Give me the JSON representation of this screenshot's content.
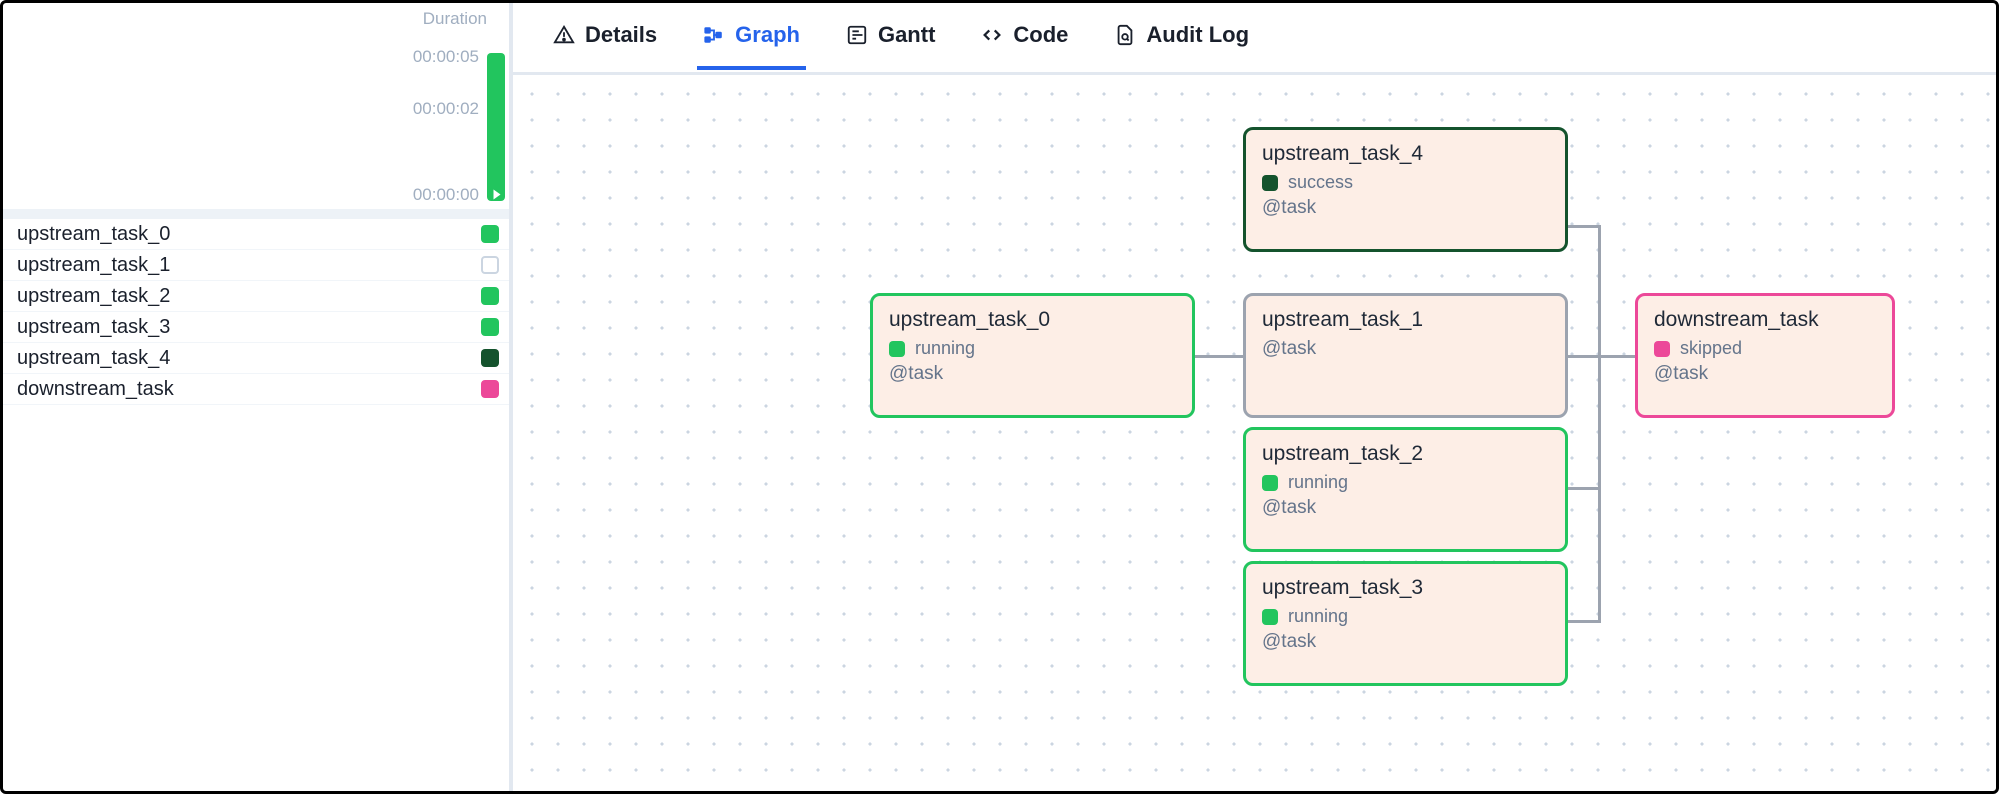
{
  "sidebar": {
    "header": "Duration",
    "ticks": {
      "high": "00:00:05",
      "mid": "00:00:02",
      "low": "00:00:00"
    },
    "tasks": [
      {
        "name": "upstream_task_0",
        "state": "running"
      },
      {
        "name": "upstream_task_1",
        "state": "none"
      },
      {
        "name": "upstream_task_2",
        "state": "running"
      },
      {
        "name": "upstream_task_3",
        "state": "running"
      },
      {
        "name": "upstream_task_4",
        "state": "success"
      },
      {
        "name": "downstream_task",
        "state": "skipped"
      }
    ]
  },
  "tabs": {
    "details": "Details",
    "graph": "Graph",
    "gantt": "Gantt",
    "code": "Code",
    "auditlog": "Audit Log",
    "active": "graph"
  },
  "graph": {
    "meta_label": "@task",
    "status_text": {
      "running": "running",
      "success": "success",
      "skipped": "skipped"
    },
    "nodes": {
      "u0": {
        "title": "upstream_task_0",
        "state": "running"
      },
      "u1": {
        "title": "upstream_task_1",
        "state": "none"
      },
      "u2": {
        "title": "upstream_task_2",
        "state": "running"
      },
      "u3": {
        "title": "upstream_task_3",
        "state": "running"
      },
      "u4": {
        "title": "upstream_task_4",
        "state": "success"
      },
      "dn": {
        "title": "downstream_task",
        "state": "skipped"
      }
    }
  },
  "colors": {
    "running": "#22c55e",
    "success": "#14532d",
    "skipped": "#ec4899",
    "none": "#9ca3af",
    "accent": "#2563eb"
  }
}
